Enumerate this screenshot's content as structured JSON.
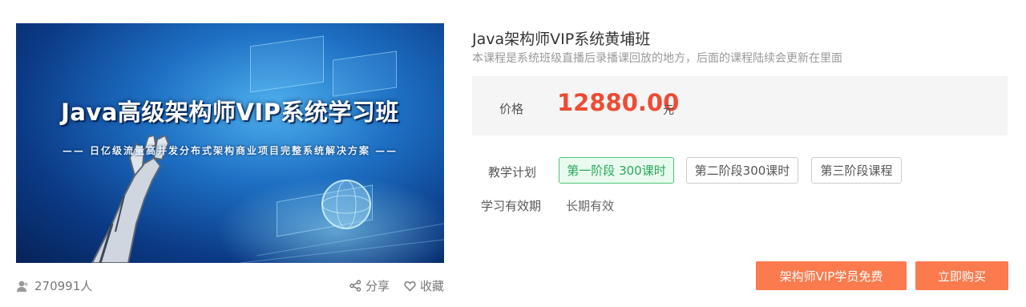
{
  "cover": {
    "title": "Java高级架构师VIP系统学习班",
    "subtitle": "—— 日亿级流量高并发分布式架构商业项目完整系统解决方案 ——"
  },
  "stats": {
    "learners_icon": "user-icon",
    "learners": "270991人",
    "share_icon": "share-icon",
    "share_label": "分享",
    "favorite_icon": "heart-icon",
    "favorite_label": "收藏"
  },
  "course": {
    "title": "Java架构师VIP系统黄埔班",
    "description": "本课程是系统班级直播后录播课回放的地方，后面的课程陆续会更新在里面"
  },
  "price": {
    "label": "价格",
    "value": "12880.00",
    "unit": "元"
  },
  "plan": {
    "label": "教学计划",
    "stages": [
      {
        "label": "第一阶段 300课时",
        "active": true
      },
      {
        "label": "第二阶段300课时",
        "active": false
      },
      {
        "label": "第三阶段课程",
        "active": false
      }
    ]
  },
  "validity": {
    "label": "学习有效期",
    "value": "长期有效"
  },
  "buttons": {
    "vip_free": "架构师VIP学员免费",
    "buy_now": "立即购买"
  },
  "colors": {
    "price": "#ee4b35",
    "button": "#fb7a4e",
    "active_stage_border": "#4cc47a",
    "active_stage_text": "#27a85a",
    "active_stage_bg": "#e9fbef",
    "price_box_bg": "#f5f5f5"
  }
}
